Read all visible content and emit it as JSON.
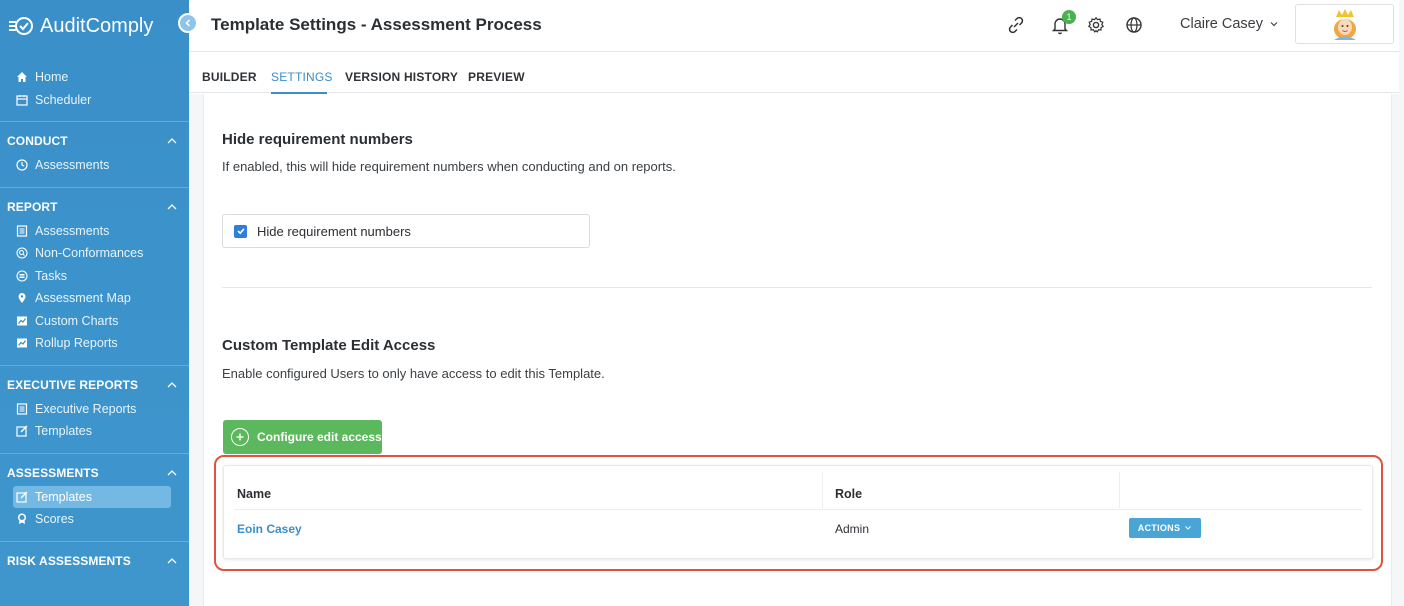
{
  "app": {
    "name": "AuditComply"
  },
  "header": {
    "title": "Template Settings - Assessment Process",
    "notification_count": "1",
    "user_name": "Claire Casey"
  },
  "sidebar": {
    "top_items": [
      {
        "label": "Home",
        "icon": "home-icon"
      },
      {
        "label": "Scheduler",
        "icon": "calendar-icon"
      }
    ],
    "groups": [
      {
        "title": "CONDUCT",
        "items": [
          {
            "label": "Assessments",
            "icon": "clock-icon"
          }
        ]
      },
      {
        "title": "REPORT",
        "items": [
          {
            "label": "Assessments",
            "icon": "document-icon"
          },
          {
            "label": "Non-Conformances",
            "icon": "search-circle-icon"
          },
          {
            "label": "Tasks",
            "icon": "list-circle-icon"
          },
          {
            "label": "Assessment Map",
            "icon": "map-pin-icon"
          },
          {
            "label": "Custom Charts",
            "icon": "chart-icon"
          },
          {
            "label": "Rollup Reports",
            "icon": "chart-icon"
          }
        ]
      },
      {
        "title": "EXECUTIVE REPORTS",
        "items": [
          {
            "label": "Executive Reports",
            "icon": "document-icon"
          },
          {
            "label": "Templates",
            "icon": "edit-icon"
          }
        ]
      },
      {
        "title": "ASSESSMENTS",
        "items": [
          {
            "label": "Templates",
            "icon": "edit-icon",
            "active": true
          },
          {
            "label": "Scores",
            "icon": "award-icon"
          }
        ]
      },
      {
        "title": "RISK ASSESSMENTS",
        "items": []
      }
    ]
  },
  "tabs": [
    "BUILDER",
    "SETTINGS",
    "VERSION HISTORY",
    "PREVIEW"
  ],
  "active_tab": "SETTINGS",
  "settings": {
    "hide_numbers": {
      "title": "Hide requirement numbers",
      "description": "If enabled, this will hide requirement numbers when conducting and on reports.",
      "checkbox_label": "Hide requirement numbers",
      "checked": true
    },
    "edit_access": {
      "title": "Custom Template Edit Access",
      "description": "Enable configured Users to only have access to edit this Template.",
      "button_label": "Configure edit access",
      "table": {
        "columns": [
          "Name",
          "Role",
          ""
        ],
        "rows": [
          {
            "name": "Eoin Casey",
            "role": "Admin",
            "action_label": "ACTIONS"
          }
        ]
      }
    }
  },
  "colors": {
    "sidebar": "#3a8fc8",
    "accent": "#3a8fc8",
    "success": "#5cb85c",
    "highlight": "#e0533d"
  }
}
